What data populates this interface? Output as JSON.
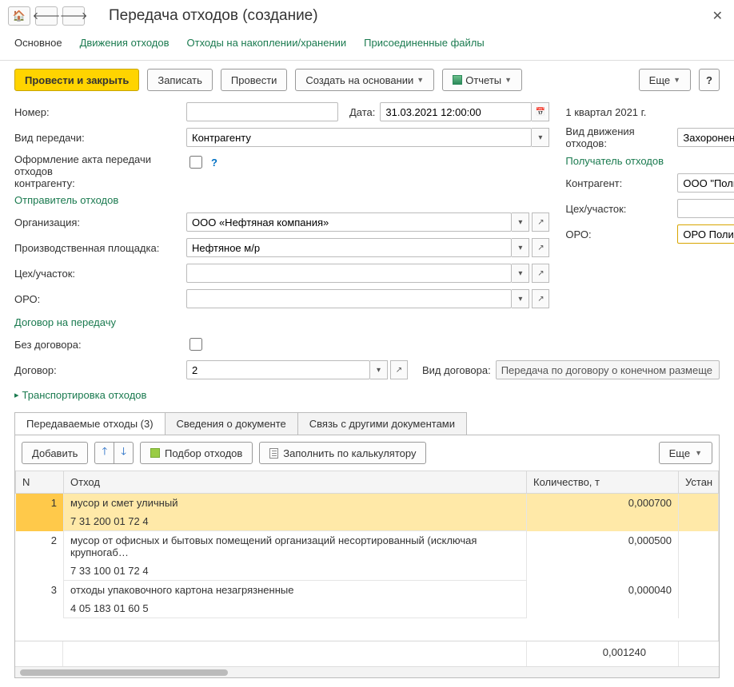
{
  "title": "Передача отходов (создание)",
  "nav_tabs": {
    "main": "Основное",
    "moves": "Движения отходов",
    "storage": "Отходы на накоплении/хранении",
    "files": "Присоединенные файлы"
  },
  "cmd": {
    "post_close": "Провести и закрыть",
    "write": "Записать",
    "post": "Провести",
    "create_based": "Создать на основании",
    "reports": "Отчеты",
    "more": "Еще",
    "help": "?"
  },
  "left": {
    "number_label": "Номер:",
    "number": "",
    "date_label": "Дата:",
    "date": "31.03.2021 12:00:00",
    "transfer_type_label": "Вид передачи:",
    "transfer_type": "Контрагенту",
    "act_label1": "Оформление акта передачи отходов",
    "act_label2": "контрагенту:",
    "sender_section": "Отправитель отходов",
    "org_label": "Организация:",
    "org": "ООО «Нефтяная компания»",
    "site_label": "Производственная площадка:",
    "site": "Нефтяное м/р",
    "workshop_label": "Цех/участок:",
    "workshop": "",
    "oro_label": "ОРО:",
    "oro": "",
    "contract_section": "Договор на передачу",
    "no_contract_label": "Без договора:",
    "contract_label": "Договор:",
    "contract": "2",
    "transport": "Транспортировка отходов"
  },
  "right": {
    "quarter": "1 квартал 2021 г.",
    "move_type_label": "Вид движения отходов:",
    "move_type": "Захоронение",
    "receiver_section": "Получатель отходов",
    "counterparty_label": "Контрагент:",
    "counterparty": "ООО \"Полигон ТБО\" г",
    "workshop_label": "Цех/участок:",
    "workshop": "",
    "oro_label": "ОРО:",
    "oro": "ОРО Полигон",
    "contract_type_label": "Вид договора:",
    "contract_type": "Передача по договору о конечном размеще"
  },
  "lower_tabs": {
    "wastes": "Передаваемые отходы (3)",
    "doc_info": "Сведения о документе",
    "links": "Связь с другими документами"
  },
  "toolbar2": {
    "add": "Добавить",
    "pick": "Подбор отходов",
    "fill": "Заполнить по калькулятору",
    "more": "Еще"
  },
  "table": {
    "col_n": "N",
    "col_waste": "Отход",
    "col_qty": "Количество, т",
    "col_inst": "Устан",
    "rows": [
      {
        "n": "1",
        "name": "мусор и смет уличный",
        "code": "7 31 200 01 72 4",
        "qty": "0,000700"
      },
      {
        "n": "2",
        "name": "мусор от офисных и бытовых помещений организаций несортированный (исключая крупногаб…",
        "code": "7 33 100 01 72 4",
        "qty": "0,000500"
      },
      {
        "n": "3",
        "name": "отходы упаковочного картона незагрязненные",
        "code": "4 05 183 01 60 5",
        "qty": "0,000040"
      }
    ],
    "total_qty": "0,001240"
  }
}
